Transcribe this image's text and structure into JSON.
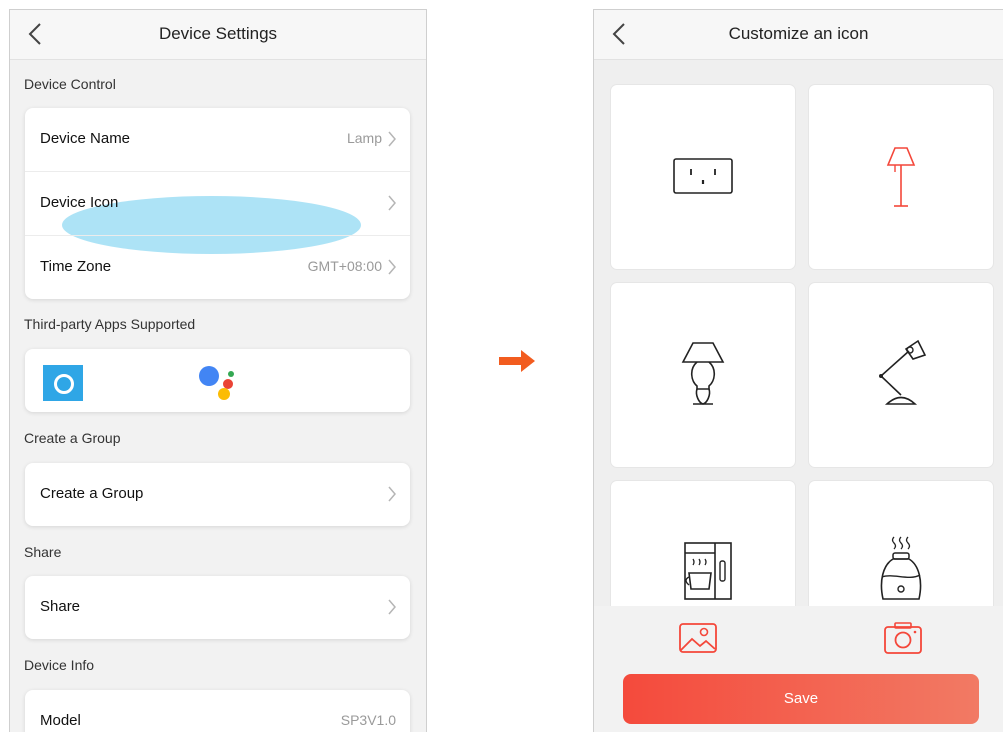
{
  "left": {
    "title": "Device Settings",
    "sections": {
      "device_control": "Device Control",
      "third_party": "Third-party Apps Supported",
      "create_group": "Create a Group",
      "share": "Share",
      "device_info": "Device Info"
    },
    "rows": {
      "device_name": {
        "label": "Device Name",
        "value": "Lamp"
      },
      "device_icon": {
        "label": "Device Icon"
      },
      "time_zone": {
        "label": "Time Zone",
        "value": "GMT+08:00"
      },
      "create_group": {
        "label": "Create a Group"
      },
      "share": {
        "label": "Share"
      },
      "model": {
        "label": "Model",
        "value": "SP3V1.0"
      }
    },
    "apps": [
      "amazon-alexa-icon",
      "google-assistant-icon"
    ]
  },
  "right": {
    "title": "Customize an icon",
    "icons": [
      "outlet-icon",
      "floor-lamp-icon",
      "table-lamp-icon",
      "desk-lamp-icon",
      "coffee-maker-icon",
      "humidifier-icon"
    ],
    "selected_icon": "floor-lamp-icon",
    "save_label": "Save"
  },
  "colors": {
    "accent": "#f4473a",
    "highlight": "#a9e1f5",
    "arrow": "#f25c1f"
  }
}
